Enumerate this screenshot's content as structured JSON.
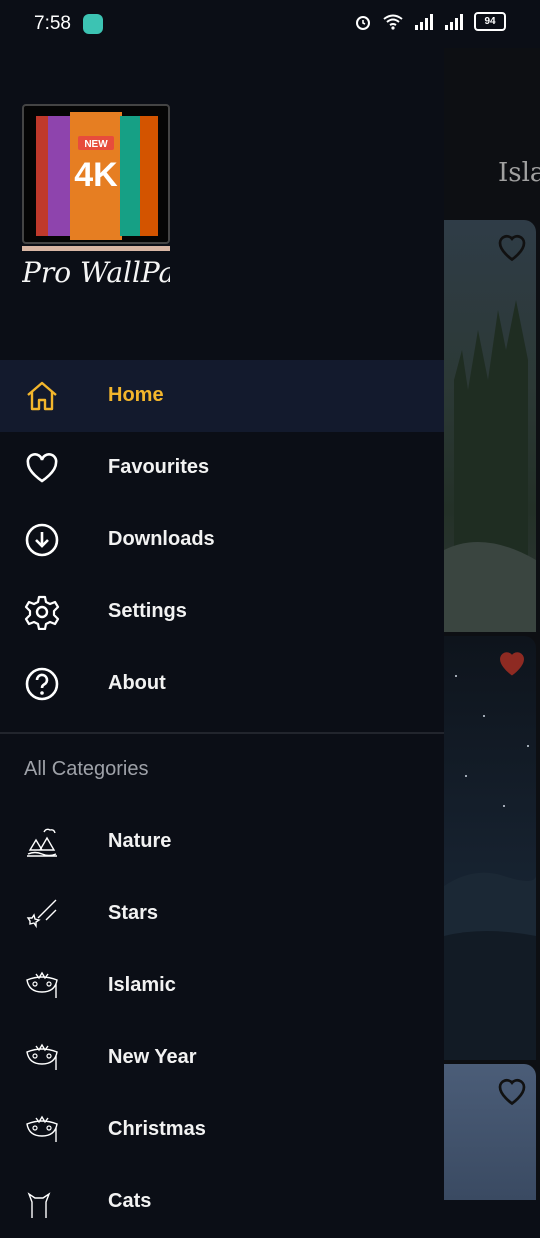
{
  "status": {
    "time": "7:58",
    "battery": "94"
  },
  "logo": {
    "badge": "NEW",
    "resolution": "4K",
    "app_name": "Pro WallPaper"
  },
  "menu": [
    {
      "label": "Home",
      "icon": "home-icon",
      "active": true
    },
    {
      "label": "Favourites",
      "icon": "heart-icon"
    },
    {
      "label": "Downloads",
      "icon": "download-icon"
    },
    {
      "label": "Settings",
      "icon": "gear-icon"
    },
    {
      "label": "About",
      "icon": "help-icon"
    }
  ],
  "categories_header": "All Categories",
  "categories": [
    {
      "label": "Nature",
      "icon": "nature-icon"
    },
    {
      "label": "Stars",
      "icon": "stars-icon"
    },
    {
      "label": "Islamic",
      "icon": "mask-icon"
    },
    {
      "label": "New Year",
      "icon": "mask-icon"
    },
    {
      "label": "Christmas",
      "icon": "mask-icon"
    },
    {
      "label": "Cats",
      "icon": "cat-icon"
    }
  ],
  "background": {
    "title": "Isla"
  },
  "colors": {
    "accent": "#f3b62c",
    "background": "#0b0e16",
    "active_row": "#131a2d",
    "favorite_red": "#c0392b"
  }
}
